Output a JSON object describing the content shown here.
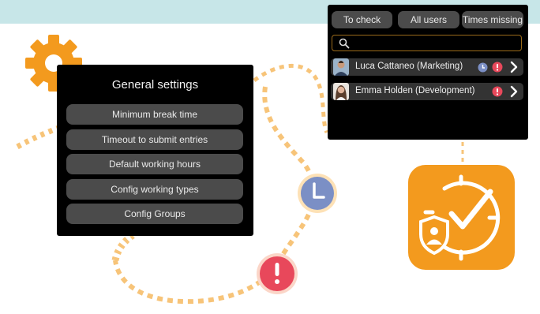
{
  "colors": {
    "accent_orange": "#f39a1e",
    "panel_bg": "#000000",
    "button_bg": "#4b4b4b",
    "row_bg": "#333333",
    "clock_blue": "#7b8fc5",
    "alert_red": "#e8485b",
    "top_band": "#c7e6e8"
  },
  "settings": {
    "title": "General settings",
    "items": [
      "Minimum break time",
      "Timeout to submit entries",
      "Default working hours",
      "Config working types",
      "Config Groups"
    ]
  },
  "users_panel": {
    "tabs": [
      "To check",
      "All users",
      "Times missing"
    ],
    "search_placeholder": "",
    "rows": [
      {
        "name": "Luca Cattaneo (Marketing)",
        "icons": [
          "clock-icon",
          "alert-icon",
          "chevron-right-icon"
        ]
      },
      {
        "name": "Emma Holden (Development)",
        "icons": [
          "alert-icon",
          "chevron-right-icon"
        ]
      }
    ]
  },
  "icons": {
    "gear": "gear-icon",
    "search": "search-icon",
    "clock_bubble": "clock-icon",
    "alert_bubble": "alert-icon",
    "app": "clock-check-shield-icon"
  }
}
